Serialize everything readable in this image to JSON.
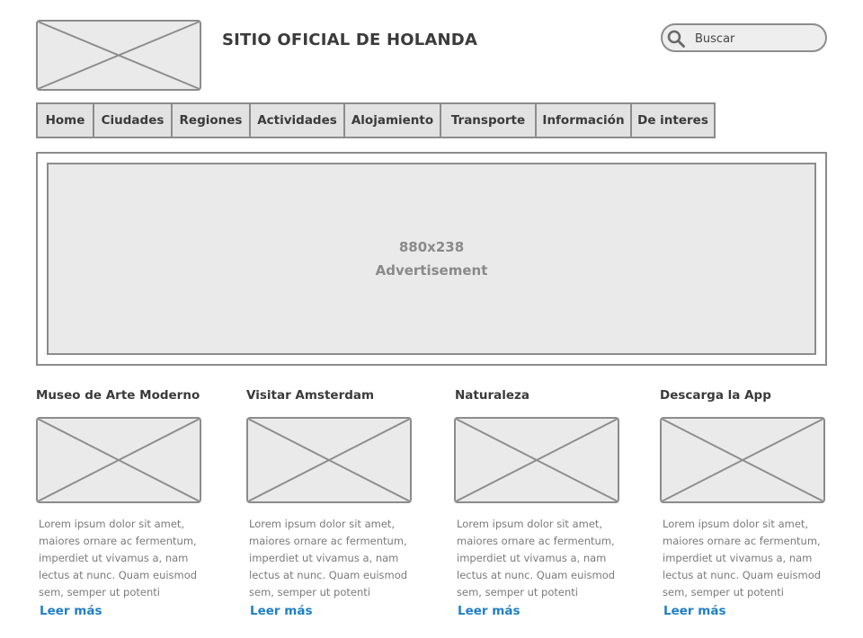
{
  "header": {
    "site_title": "SITIO OFICIAL DE HOLANDA",
    "search_placeholder": "Buscar",
    "logo_icon": "image-placeholder-icon"
  },
  "nav": {
    "items": [
      {
        "label": "Home"
      },
      {
        "label": "Ciudades"
      },
      {
        "label": "Regiones"
      },
      {
        "label": "Actividades"
      },
      {
        "label": "Alojamiento"
      },
      {
        "label": "Transporte"
      },
      {
        "label": "Información"
      },
      {
        "label": "De interes"
      }
    ]
  },
  "advertisement": {
    "size": "880x238",
    "label": "Advertisement"
  },
  "cards": [
    {
      "title": "Museo de Arte Moderno",
      "text_lines": [
        "Lorem ipsum dolor sit amet,",
        "maiores ornare ac fermentum,",
        "imperdiet ut vivamus a, nam",
        "lectus at nunc. Quam euismod",
        "sem, semper ut potenti"
      ],
      "link": "Leer más"
    },
    {
      "title": "Visitar Amsterdam",
      "text_lines": [
        "Lorem ipsum dolor sit amet,",
        "maiores ornare ac fermentum,",
        "imperdiet ut vivamus a, nam",
        "lectus at nunc. Quam euismod",
        "sem, semper ut potenti"
      ],
      "link": "Leer más"
    },
    {
      "title": "Naturaleza",
      "text_lines": [
        "Lorem ipsum dolor sit amet,",
        "maiores ornare ac fermentum,",
        "imperdiet ut vivamus a, nam",
        "lectus at nunc. Quam euismod",
        "sem, semper ut potenti"
      ],
      "link": "Leer más"
    },
    {
      "title": "Descarga la App",
      "text_lines": [
        "Lorem ipsum dolor sit amet,",
        "maiores ornare ac fermentum,",
        "imperdiet ut vivamus a, nam",
        "lectus at nunc. Quam euismod",
        "sem, semper ut potenti"
      ],
      "link": "Leer más"
    }
  ],
  "colors": {
    "border": "#8c8c8c",
    "placeholder_fill": "#eaeaea",
    "link": "#1f7fc7",
    "text": "#3a3a3a",
    "body_text": "#7a7a7a"
  }
}
